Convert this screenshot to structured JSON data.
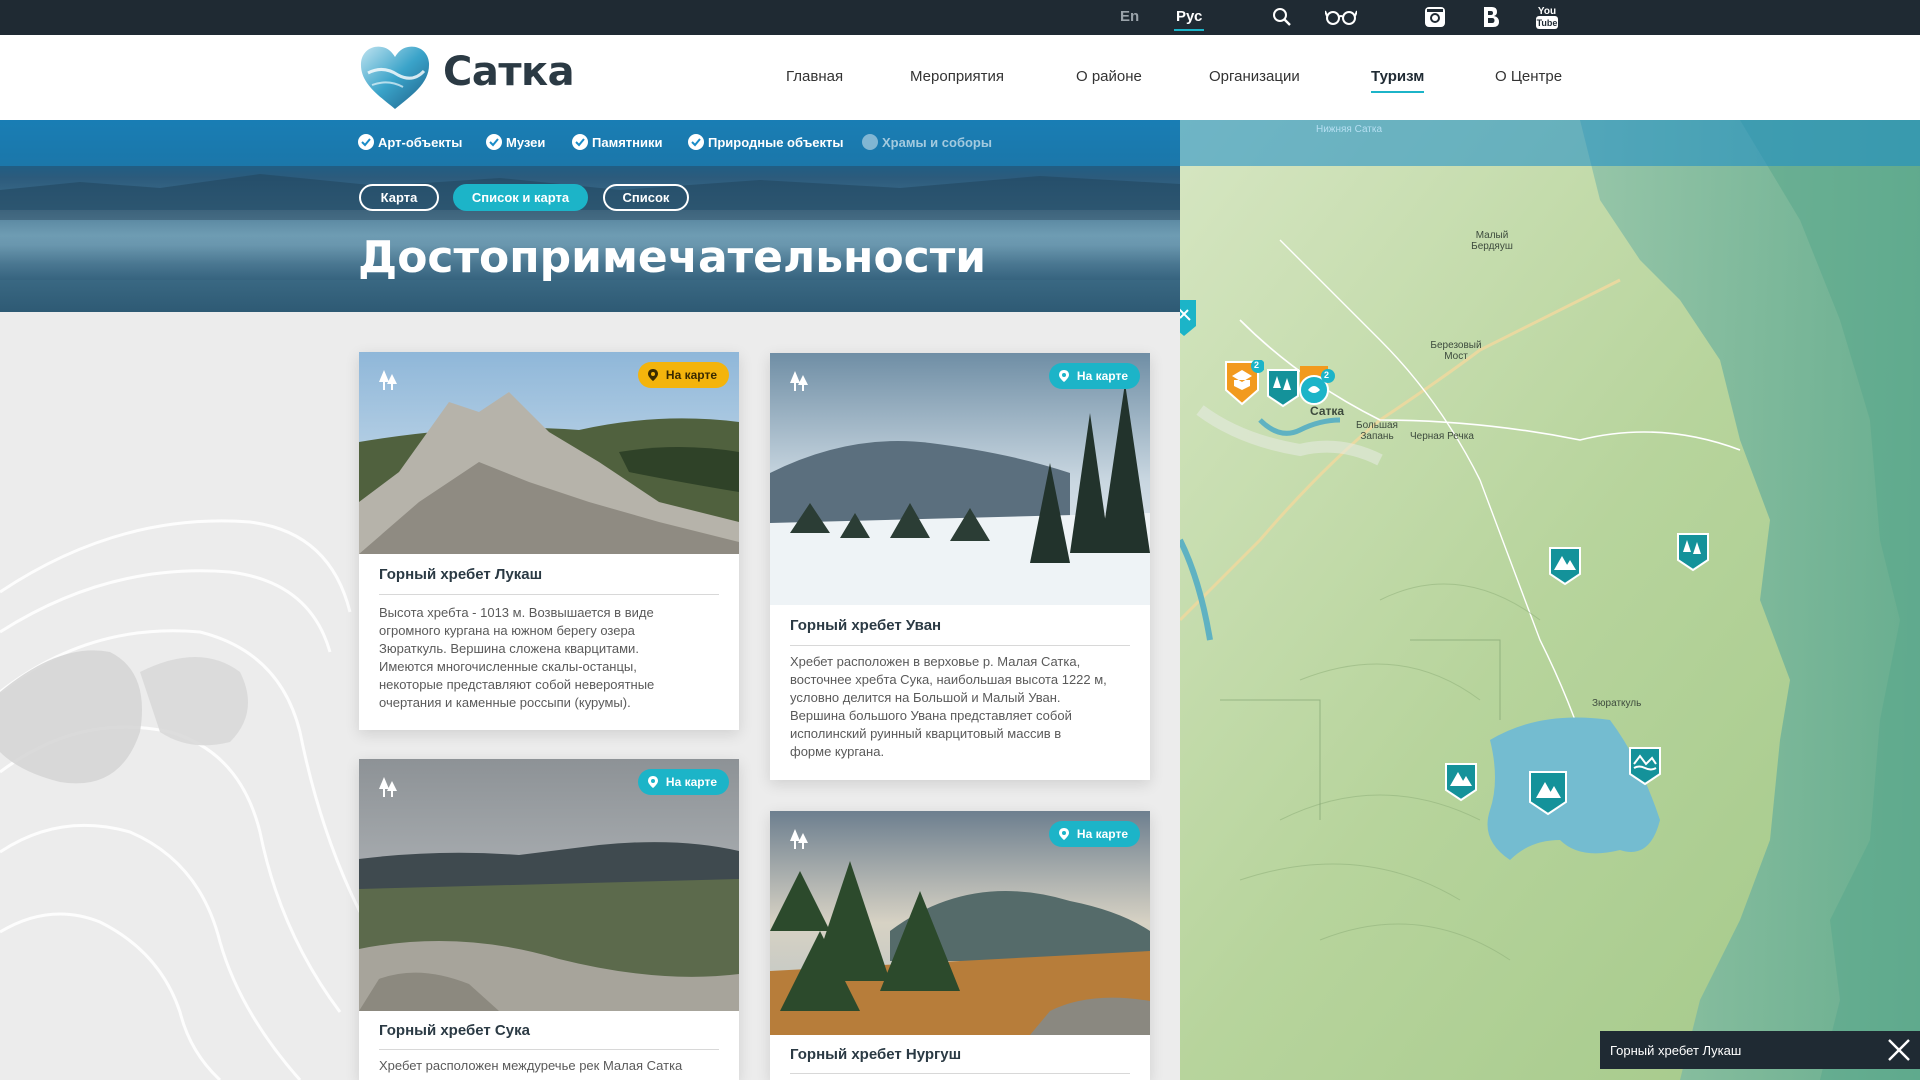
{
  "topbar": {
    "lang_en": "En",
    "lang_ru": "Рус",
    "icons": [
      "search-icon",
      "glasses-icon",
      "instagram-icon",
      "vk-icon",
      "youtube-icon"
    ],
    "youtube_text_1": "You",
    "youtube_text_2": "Tube"
  },
  "header": {
    "logo_text": "Сатка",
    "nav": [
      {
        "label": "Главная"
      },
      {
        "label": "Мероприятия"
      },
      {
        "label": "О районе"
      },
      {
        "label": "Организации"
      },
      {
        "label": "Туризм",
        "active": true
      },
      {
        "label": "О Центре"
      }
    ]
  },
  "filters": [
    {
      "label": "Арт-объекты",
      "checked": true
    },
    {
      "label": "Музеи",
      "checked": true
    },
    {
      "label": "Памятники",
      "checked": true
    },
    {
      "label": "Природные объекты",
      "checked": true
    },
    {
      "label": "Храмы и соборы",
      "checked": false
    }
  ],
  "view_modes": [
    {
      "label": "Карта",
      "active": false
    },
    {
      "label": "Список и карта",
      "active": true
    },
    {
      "label": "Список",
      "active": false
    }
  ],
  "page_title": "Достопримечательности",
  "cards": [
    {
      "title": "Горный хребет Лукаш",
      "on_map": "На карте",
      "badge_color": "yellow",
      "description": [
        "Высота хребта - 1013 м. Возвышается в виде",
        "огромного кургана на южном берегу озера",
        "Зюраткуль. Вершина сложена кварцитами.",
        "Имеются многочисленные скалы-останцы,",
        "некоторые представляют собой невероятные",
        "очертания и каменные россыпи (курумы)."
      ]
    },
    {
      "title": "Горный хребет Уван",
      "on_map": "На карте",
      "badge_color": "teal",
      "description": [
        "Хребет расположен в верховье р. Малая Сатка,",
        "восточнее хребта Сука, наибольшая высота 1222 м,",
        "условно делится на Большой и Малый Уван.",
        "Вершина большого Увана представляет собой",
        "исполинский руинный кварцитовый массив в",
        "форме кургана."
      ]
    },
    {
      "title": "Горный хребет Сука",
      "on_map": "На карте",
      "badge_color": "teal",
      "description": [
        "Хребет расположен междуречье рек Малая Сатка"
      ]
    },
    {
      "title": "Горный хребет Нургуш",
      "on_map": "На карте",
      "badge_color": "teal",
      "description": []
    }
  ],
  "map": {
    "labels": [
      {
        "text": "Нижняя Сатка"
      },
      {
        "text": "Малый Бердяуш"
      },
      {
        "text": "Березовый Мост"
      },
      {
        "text": "Сатка"
      },
      {
        "text": "Большая Запань"
      },
      {
        "text": "Черная Речка"
      },
      {
        "text": "Зюраткуль"
      }
    ],
    "cluster_counts": [
      "2",
      "2"
    ],
    "tooltip": "Горный хребет Лукаш"
  },
  "colors": {
    "accent": "#1cb4c8",
    "yellow_badge": "#f4b40c",
    "dark_bar": "#1f2a33",
    "marker_teal": "#14929a",
    "marker_orange": "#f29a1e"
  }
}
